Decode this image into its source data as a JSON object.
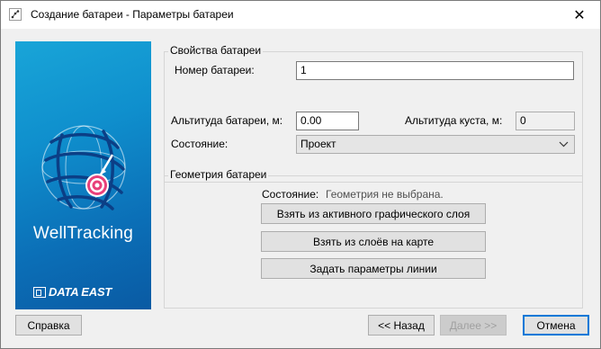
{
  "window": {
    "title": "Создание батареи - Параметры батареи",
    "close_glyph": "✕"
  },
  "banner": {
    "brand": "WellTracking",
    "vendor": "DATA EAST"
  },
  "properties": {
    "group_label": "Свойства батареи",
    "number_label": "Номер батареи:",
    "number_value": "1",
    "altitude_label": "Альтитуда батареи, м:",
    "altitude_value": "0.00",
    "cluster_altitude_label": "Альтитуда куста, м:",
    "cluster_altitude_value": "0",
    "state_label": "Состояние:",
    "state_value": "Проект"
  },
  "geometry": {
    "group_label": "Геометрия батареи",
    "state_label": "Состояние:",
    "state_value": "Геометрия не выбрана.",
    "btn_active_layer": "Взять из активного графического слоя",
    "btn_map_layers": "Взять из слоёв на карте",
    "btn_line_params": "Задать параметры линии"
  },
  "footer": {
    "help": "Справка",
    "back": "<< Назад",
    "next": "Далее >>",
    "cancel": "Отмена"
  },
  "colors": {
    "banner_top": "#19a5d8",
    "banner_bottom": "#0a5aa3",
    "accent": "#0078d7"
  }
}
